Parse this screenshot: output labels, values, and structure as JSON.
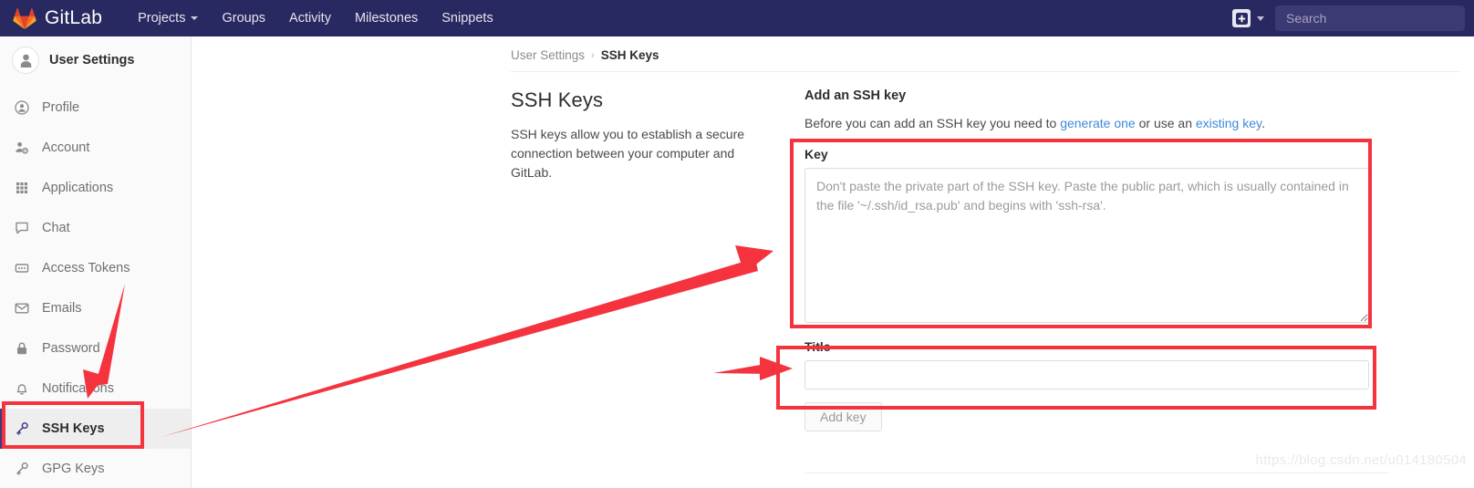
{
  "navbar": {
    "brand": "GitLab",
    "brand_icon": "gitlab-tanuki-logo",
    "links": [
      {
        "label": "Projects",
        "has_caret": true
      },
      {
        "label": "Groups",
        "has_caret": false
      },
      {
        "label": "Activity",
        "has_caret": false
      },
      {
        "label": "Milestones",
        "has_caret": false
      },
      {
        "label": "Snippets",
        "has_caret": false
      }
    ],
    "new_button_icon": "plus-square-icon",
    "new_button_caret_icon": "chevron-down-icon",
    "search_placeholder": "Search"
  },
  "sidebar": {
    "title": "User Settings",
    "avatar_icon": "user-avatar-icon",
    "items": [
      {
        "label": "Profile",
        "icon": "user-circle-icon",
        "active": false
      },
      {
        "label": "Account",
        "icon": "user-gear-icon",
        "active": false
      },
      {
        "label": "Applications",
        "icon": "grid-dots-icon",
        "active": false
      },
      {
        "label": "Chat",
        "icon": "chat-bubble-icon",
        "active": false
      },
      {
        "label": "Access Tokens",
        "icon": "token-card-icon",
        "active": false
      },
      {
        "label": "Emails",
        "icon": "envelope-icon",
        "active": false
      },
      {
        "label": "Password",
        "icon": "lock-icon",
        "active": false
      },
      {
        "label": "Notifications",
        "icon": "bell-icon",
        "active": false
      },
      {
        "label": "SSH Keys",
        "icon": "key-icon",
        "active": true
      },
      {
        "label": "GPG Keys",
        "icon": "key-icon",
        "active": false
      }
    ]
  },
  "breadcrumb": {
    "parent": "User Settings",
    "separator": "›",
    "current": "SSH Keys"
  },
  "main": {
    "heading": "SSH Keys",
    "description": "SSH keys allow you to establish a secure connection between your computer and GitLab."
  },
  "form": {
    "heading": "Add an SSH key",
    "lead_prefix": "Before you can add an SSH key you need to ",
    "lead_link_1": "generate one",
    "lead_middle": " or use an ",
    "lead_link_2": "existing key",
    "lead_suffix": ".",
    "key_label": "Key",
    "key_value": "",
    "key_placeholder": "Don't paste the private part of the SSH key. Paste the public part, which is usually contained in the file '~/.ssh/id_rsa.pub' and begins with 'ssh-rsa'.",
    "title_label": "Title",
    "title_value": "",
    "title_placeholder": "",
    "submit_label": "Add key"
  },
  "annotations": {
    "highlight_color": "#f5333f",
    "boxes": [
      {
        "name": "key-field-highlight",
        "target": "Key"
      },
      {
        "name": "title-field-highlight",
        "target": "Title"
      },
      {
        "name": "ssh-keys-nav-highlight",
        "target": "SSH Keys"
      }
    ],
    "arrows": [
      {
        "name": "arrow-to-notifications",
        "target": "Notifications"
      },
      {
        "name": "arrow-ssh-keys-to-key-field",
        "target": "Key"
      },
      {
        "name": "arrow-to-title-field",
        "target": "Title"
      }
    ]
  },
  "watermark": {
    "text": "https://blog.csdn.net/u014180504"
  }
}
